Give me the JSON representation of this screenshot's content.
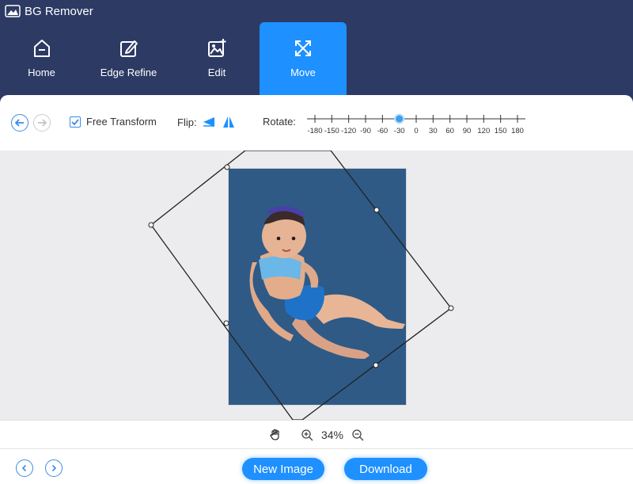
{
  "app": {
    "title": "BG Remover"
  },
  "nav": {
    "tabs": [
      {
        "label": "Home",
        "icon": "home-icon"
      },
      {
        "label": "Edge Refine",
        "icon": "edge-refine-icon"
      },
      {
        "label": "Edit",
        "icon": "edit-image-icon"
      },
      {
        "label": "Move",
        "icon": "move-icon",
        "active": true
      }
    ]
  },
  "toolbar": {
    "free_transform_label": "Free Transform",
    "free_transform_checked": true,
    "flip_label": "Flip:",
    "rotate_label": "Rotate:",
    "rotate_ticks": [
      "-180",
      "-150",
      "-120",
      "-90",
      "-60",
      "-30",
      "0",
      "30",
      "60",
      "90",
      "120",
      "150",
      "180"
    ],
    "rotate_value": -30
  },
  "zoom": {
    "value": "34%"
  },
  "actions": {
    "new_image": "New Image",
    "download": "Download"
  },
  "colors": {
    "header_bg": "#2c3a64",
    "accent": "#1e90ff",
    "image_bg": "#2f5a86"
  }
}
